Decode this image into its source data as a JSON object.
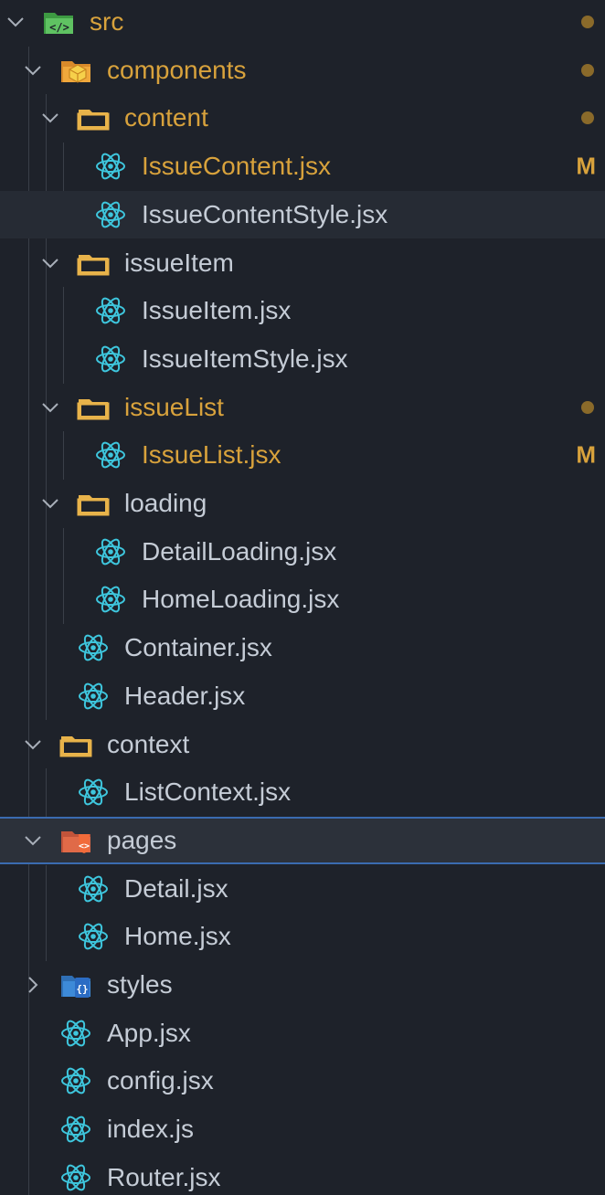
{
  "colors": {
    "background": "#1e222a",
    "text": "#c5ccd6",
    "modified": "#d8a23c",
    "selected_border": "#3a6bb0",
    "react_icon": "#3ec6dd"
  },
  "tree": [
    {
      "label": "src",
      "depth": 0,
      "type": "folder",
      "expanded": true,
      "icon": "folder-src-icon",
      "status": "dot",
      "modified": true
    },
    {
      "label": "components",
      "depth": 1,
      "type": "folder",
      "expanded": true,
      "icon": "folder-components-icon",
      "status": "dot",
      "modified": true
    },
    {
      "label": "content",
      "depth": 2,
      "type": "folder",
      "expanded": true,
      "icon": "folder-icon",
      "status": "dot",
      "modified": true
    },
    {
      "label": "IssueContent.jsx",
      "depth": 3,
      "type": "file",
      "icon": "react-icon",
      "status": "M",
      "modified": true
    },
    {
      "label": "IssueContentStyle.jsx",
      "depth": 3,
      "type": "file",
      "icon": "react-icon",
      "state": "hover"
    },
    {
      "label": "issueItem",
      "depth": 2,
      "type": "folder",
      "expanded": true,
      "icon": "folder-icon"
    },
    {
      "label": "IssueItem.jsx",
      "depth": 3,
      "type": "file",
      "icon": "react-icon"
    },
    {
      "label": "IssueItemStyle.jsx",
      "depth": 3,
      "type": "file",
      "icon": "react-icon"
    },
    {
      "label": "issueList",
      "depth": 2,
      "type": "folder",
      "expanded": true,
      "icon": "folder-icon",
      "status": "dot",
      "modified": true
    },
    {
      "label": "IssueList.jsx",
      "depth": 3,
      "type": "file",
      "icon": "react-icon",
      "status": "M",
      "modified": true
    },
    {
      "label": "loading",
      "depth": 2,
      "type": "folder",
      "expanded": true,
      "icon": "folder-icon"
    },
    {
      "label": "DetailLoading.jsx",
      "depth": 3,
      "type": "file",
      "icon": "react-icon"
    },
    {
      "label": "HomeLoading.jsx",
      "depth": 3,
      "type": "file",
      "icon": "react-icon"
    },
    {
      "label": "Container.jsx",
      "depth": 2,
      "type": "file",
      "icon": "react-icon"
    },
    {
      "label": "Header.jsx",
      "depth": 2,
      "type": "file",
      "icon": "react-icon"
    },
    {
      "label": "context",
      "depth": 1,
      "type": "folder",
      "expanded": true,
      "icon": "folder-icon"
    },
    {
      "label": "ListContext.jsx",
      "depth": 2,
      "type": "file",
      "icon": "react-icon"
    },
    {
      "label": "pages",
      "depth": 1,
      "type": "folder",
      "expanded": true,
      "icon": "folder-pages-icon",
      "state": "selected"
    },
    {
      "label": "Detail.jsx",
      "depth": 2,
      "type": "file",
      "icon": "react-icon"
    },
    {
      "label": "Home.jsx",
      "depth": 2,
      "type": "file",
      "icon": "react-icon"
    },
    {
      "label": "styles",
      "depth": 1,
      "type": "folder",
      "expanded": false,
      "icon": "folder-styles-icon"
    },
    {
      "label": "App.jsx",
      "depth": 1,
      "type": "file",
      "icon": "react-icon"
    },
    {
      "label": "config.jsx",
      "depth": 1,
      "type": "file",
      "icon": "react-icon"
    },
    {
      "label": "index.js",
      "depth": 1,
      "type": "file",
      "icon": "react-icon"
    },
    {
      "label": "Router.jsx",
      "depth": 1,
      "type": "file",
      "icon": "react-icon"
    }
  ]
}
